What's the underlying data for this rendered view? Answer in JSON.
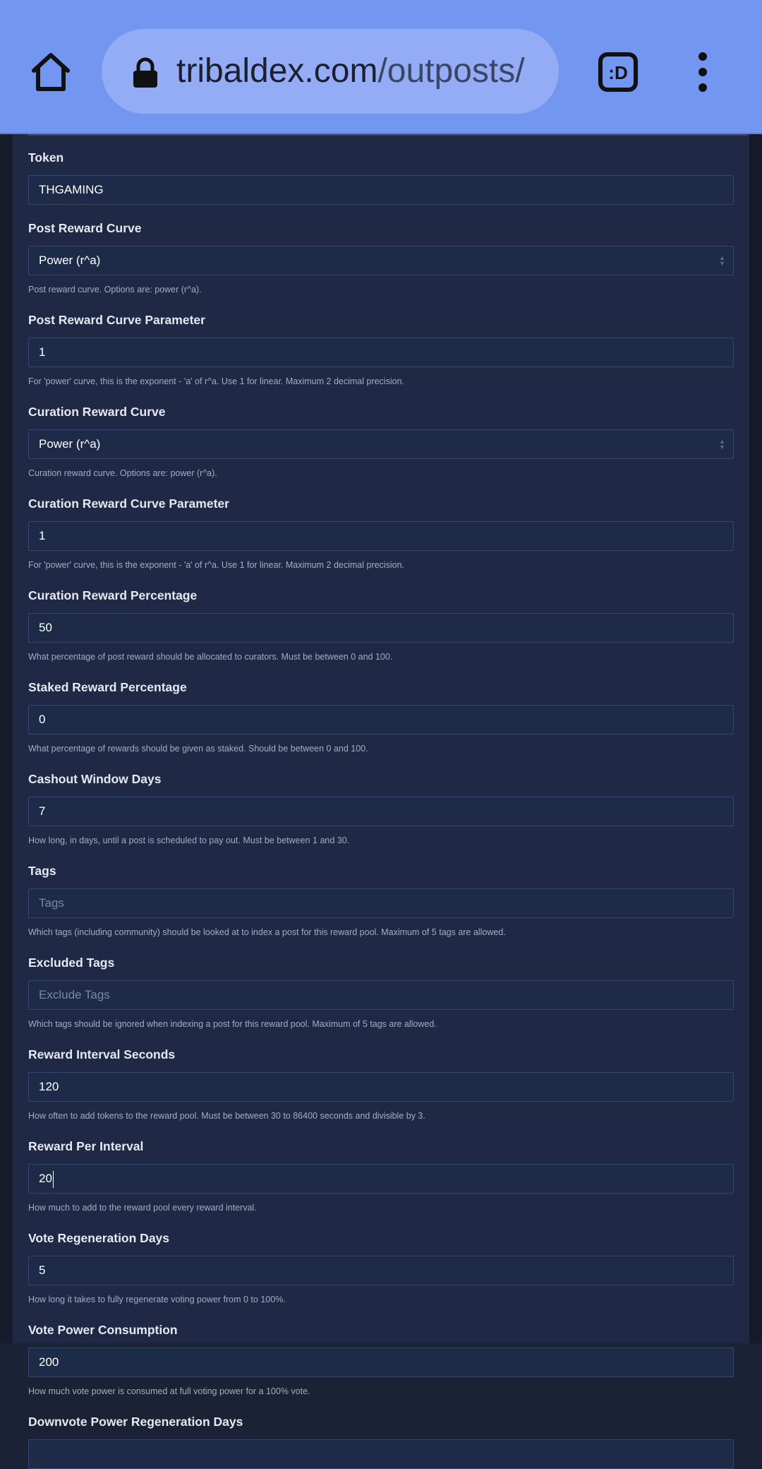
{
  "browser": {
    "url_domain": "tribaldex.com",
    "url_path": "/outposts/",
    "tab_switcher_label": ":D"
  },
  "form": {
    "token": {
      "label": "Token",
      "value": "THGAMING"
    },
    "post_reward_curve": {
      "label": "Post Reward Curve",
      "value": "Power (r^a)",
      "help": "Post reward curve. Options are: power (r^a)."
    },
    "post_reward_curve_parameter": {
      "label": "Post Reward Curve Parameter",
      "value": "1",
      "help": "For 'power' curve, this is the exponent - 'a' of r^a. Use 1 for linear. Maximum 2 decimal precision."
    },
    "curation_reward_curve": {
      "label": "Curation Reward Curve",
      "value": "Power (r^a)",
      "help": "Curation reward curve. Options are: power (r^a)."
    },
    "curation_reward_curve_parameter": {
      "label": "Curation Reward Curve Parameter",
      "value": "1",
      "help": "For 'power' curve, this is the exponent - 'a' of r^a. Use 1 for linear. Maximum 2 decimal precision."
    },
    "curation_reward_percentage": {
      "label": "Curation Reward Percentage",
      "value": "50",
      "help": "What percentage of post reward should be allocated to curators. Must be between 0 and 100."
    },
    "staked_reward_percentage": {
      "label": "Staked Reward Percentage",
      "value": "0",
      "help": "What percentage of rewards should be given as staked. Should be between 0 and 100."
    },
    "cashout_window_days": {
      "label": "Cashout Window Days",
      "value": "7",
      "help": "How long, in days, until a post is scheduled to pay out. Must be between 1 and 30."
    },
    "tags": {
      "label": "Tags",
      "placeholder": "Tags",
      "help": "Which tags (including community) should be looked at to index a post for this reward pool. Maximum of 5 tags are allowed."
    },
    "excluded_tags": {
      "label": "Excluded Tags",
      "placeholder": "Exclude Tags",
      "help": "Which tags should be ignored when indexing a post for this reward pool. Maximum of 5 tags are allowed."
    },
    "reward_interval_seconds": {
      "label": "Reward Interval Seconds",
      "value": "120",
      "help": "How often to add tokens to the reward pool. Must be between 30 to 86400 seconds and divisible by 3."
    },
    "reward_per_interval": {
      "label": "Reward Per Interval",
      "value": "20",
      "help": "How much to add to the reward pool every reward interval."
    },
    "vote_regeneration_days": {
      "label": "Vote Regeneration Days",
      "value": "5",
      "help": "How long it takes to fully regenerate voting power from 0 to 100%."
    },
    "vote_power_consumption": {
      "label": "Vote Power Consumption",
      "value": "200",
      "help": "How much vote power is consumed at full voting power for a 100% vote."
    },
    "downvote_power_regeneration_days": {
      "label": "Downvote Power Regeneration Days"
    }
  }
}
